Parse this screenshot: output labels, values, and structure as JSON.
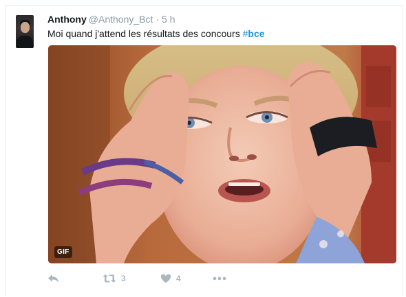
{
  "tweet": {
    "author": {
      "full_name": "Anthony",
      "username": "@Anthony_Bct"
    },
    "separator": "·",
    "time": "5 h",
    "text_before_hashtag": "Moi quand j'attend les résultats des concours ",
    "hashtag_symbol": "#",
    "hashtag_tag": "bce",
    "media": {
      "badge": "GIF"
    },
    "actions": {
      "reply_icon": "reply-icon",
      "retweet_icon": "retweet-icon",
      "retweet_count": "3",
      "like_icon": "heart-icon",
      "like_count": "4",
      "more_icon": "more-dots-icon"
    }
  },
  "colors": {
    "name": "#14171a",
    "secondary": "#8899a6",
    "link": "#1b95e0",
    "action": "#aab8c2"
  }
}
